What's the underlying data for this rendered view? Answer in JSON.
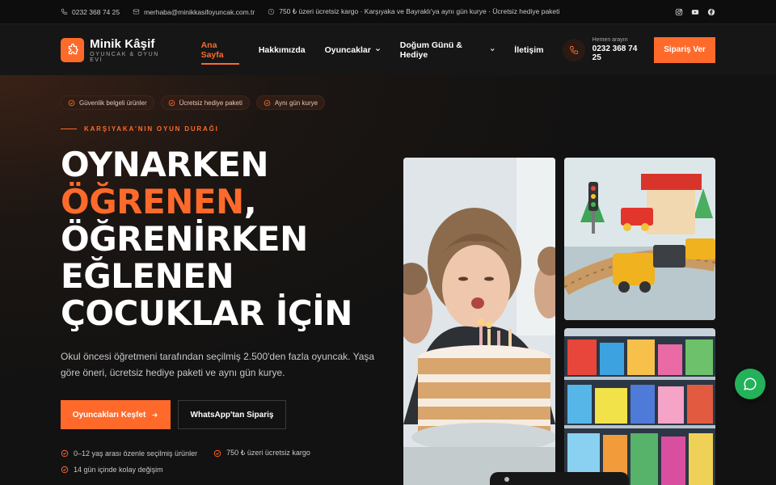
{
  "topbar": {
    "phone": "0232 368 74 25",
    "email": "merhaba@minikkasifoyuncak.com.tr",
    "promo": "750 ₺ üzeri ücretsiz kargo · Karşıyaka ve Bayraklı'ya aynı gün kurye · Ücretsiz hediye paketi",
    "icons": [
      "phone-icon",
      "mail-icon",
      "clock-icon",
      "instagram-icon",
      "youtube-icon",
      "facebook-icon"
    ]
  },
  "header": {
    "brand": "Minik Kâşif",
    "tagline": "OYUNCAK & OYUN EVİ",
    "nav": [
      {
        "label": "Ana Sayfa",
        "active": true
      },
      {
        "label": "Hakkımızda"
      },
      {
        "label": "Oyuncaklar",
        "dropdown": true
      },
      {
        "label": "Doğum Günü & Hediye",
        "dropdown": true
      },
      {
        "label": "İletişim"
      }
    ],
    "call_label": "Hemen arayın",
    "call_number": "0232 368 74 25",
    "order_button": "Sipariş Ver"
  },
  "hero": {
    "badges": [
      "Güvenlik belgeli ürünler",
      "Ücretsiz hediye paketi",
      "Aynı gün kurye"
    ],
    "kicker": "KARŞIYAKA'NIN OYUN DURAĞI",
    "headline": {
      "line1": "OYNARKEN",
      "line2_accent": "ÖĞRENEN",
      "line2_suffix": ",",
      "line3": "ÖĞRENİRKEN",
      "line4": "EĞLENEN",
      "line5": "ÇOCUKLAR İÇİN"
    },
    "description": "Okul öncesi öğretmeni tarafından seçilmiş 2.500'den fazla oyuncak. Yaşa göre öneri, ücretsiz hediye paketi ve aynı gün kurye.",
    "cta_primary": "Oyuncakları Keşfet",
    "cta_secondary": "WhatsApp'tan Sipariş",
    "features": [
      "0–12 yaş arası özenle seçilmiş ürünler",
      "750 ₺ üzeri ücretsiz kargo",
      "14 gün içinde kolay değişim"
    ]
  },
  "colors": {
    "accent": "#ff6a2b",
    "background": "#121212",
    "whatsapp": "#23b15a"
  }
}
